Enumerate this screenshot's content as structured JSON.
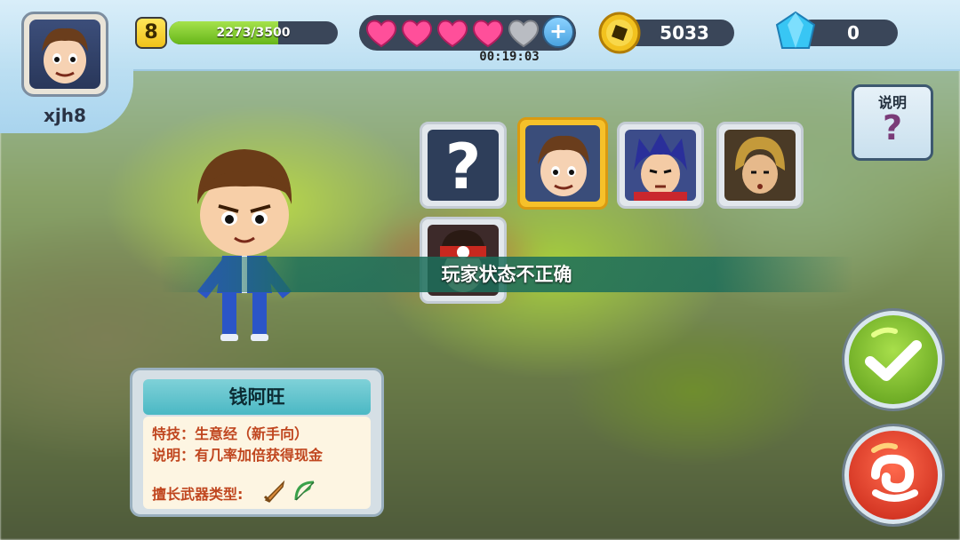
{
  "player": {
    "name": "xjh8",
    "level": "8",
    "xp_text": "2273/3500",
    "xp_fraction": 0.6494
  },
  "stamina": {
    "hearts_total": 5,
    "hearts_full": 4,
    "timer": "00:19:03"
  },
  "currency": {
    "coins": "5033",
    "gems": "0"
  },
  "help": {
    "label": "说明",
    "symbol": "?"
  },
  "characters": [
    {
      "slot": "random",
      "symbol": "?",
      "icon": "question-mark-icon",
      "selected": false
    },
    {
      "slot": "boy-brown-hair",
      "icon": "character-portrait-brown-hair-icon",
      "selected": true
    },
    {
      "slot": "blue-hair",
      "icon": "character-portrait-blue-hair-icon",
      "selected": false
    },
    {
      "slot": "golden-helmet",
      "icon": "character-portrait-golden-helmet-icon",
      "selected": false
    },
    {
      "slot": "red-headband",
      "icon": "character-portrait-red-headband-icon",
      "selected": false
    }
  ],
  "banner": {
    "message": "玩家状态不正确"
  },
  "info_card": {
    "character_name": "钱阿旺",
    "skill_line": "特技：生意经（新手向）",
    "desc_line": "说明：有几率加倍获得现金",
    "weapon_label": "擅长武器类型:",
    "weapon_icons": [
      "sword-icon",
      "bow-icon"
    ]
  },
  "buttons": {
    "confirm_icon": "checkmark-icon",
    "back_icon": "swirl-back-icon"
  },
  "colors": {
    "selected_slot": "#f6c12a",
    "confirm": "#6fb52a",
    "back": "#e03a23",
    "banner": "#1c6e5a"
  }
}
